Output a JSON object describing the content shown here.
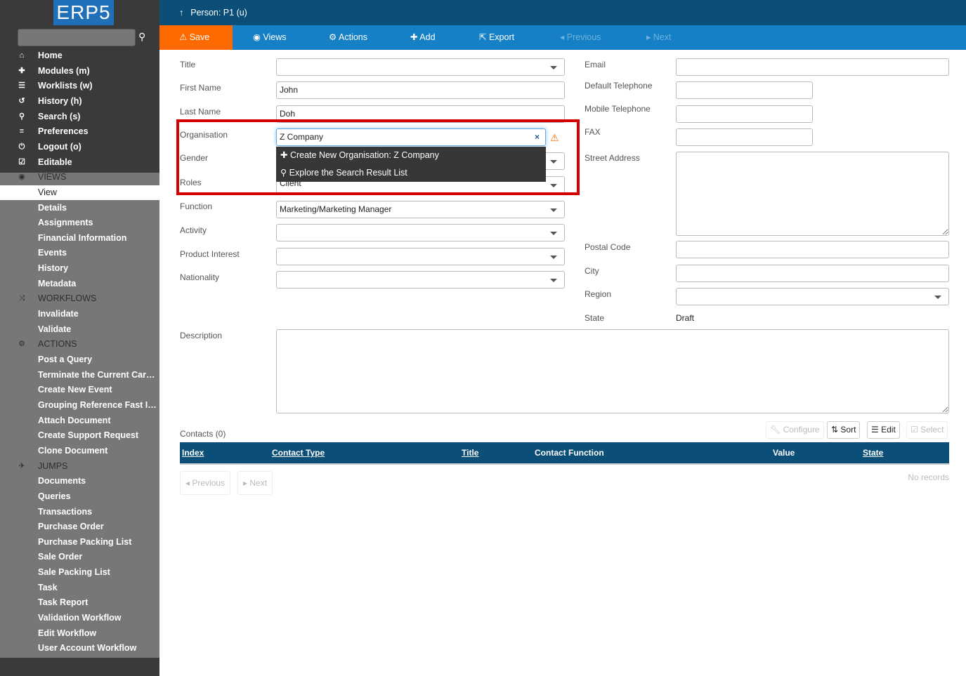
{
  "sidebar": {
    "logo": "ERP5",
    "search_placeholder": "",
    "items": [
      {
        "label": "Home",
        "icon": "home-icon",
        "glyph": "⌂",
        "type": "link"
      },
      {
        "label": "Modules (m)",
        "icon": "puzzle-icon",
        "glyph": "✚",
        "type": "link"
      },
      {
        "label": "Worklists (w)",
        "icon": "list-icon",
        "glyph": "☰",
        "type": "link"
      },
      {
        "label": "History (h)",
        "icon": "history-icon",
        "glyph": "↺",
        "type": "link"
      },
      {
        "label": "Search (s)",
        "icon": "search-icon",
        "glyph": "⚲",
        "type": "link"
      },
      {
        "label": "Preferences",
        "icon": "sliders-icon",
        "glyph": "≡",
        "type": "link"
      },
      {
        "label": "Logout (o)",
        "icon": "power-icon",
        "glyph": "⏻",
        "type": "link"
      },
      {
        "label": "Editable",
        "icon": "checkbox-checked-icon",
        "glyph": "☑",
        "type": "link"
      },
      {
        "label": "VIEWS",
        "icon": "eye-icon",
        "glyph": "◉",
        "type": "section"
      },
      {
        "label": "View",
        "type": "active"
      },
      {
        "label": "Details",
        "type": "link"
      },
      {
        "label": "Assignments",
        "type": "link"
      },
      {
        "label": "Financial Information",
        "type": "link"
      },
      {
        "label": "Events",
        "type": "link"
      },
      {
        "label": "History",
        "type": "link"
      },
      {
        "label": "Metadata",
        "type": "link"
      },
      {
        "label": "WORKFLOWS",
        "icon": "shuffle-icon",
        "glyph": "⤨",
        "type": "section"
      },
      {
        "label": "Invalidate",
        "type": "link"
      },
      {
        "label": "Validate",
        "type": "link"
      },
      {
        "label": "ACTIONS",
        "icon": "gears-icon",
        "glyph": "⚙",
        "type": "section"
      },
      {
        "label": "Post a Query",
        "type": "link"
      },
      {
        "label": "Terminate the Current Career…",
        "type": "link"
      },
      {
        "label": "Create New Event",
        "type": "link"
      },
      {
        "label": "Grouping Reference Fast Input",
        "type": "link"
      },
      {
        "label": "Attach Document",
        "type": "link"
      },
      {
        "label": "Create Support Request",
        "type": "link"
      },
      {
        "label": "Clone Document",
        "type": "link"
      },
      {
        "label": "JUMPS",
        "icon": "plane-icon",
        "glyph": "✈",
        "type": "section"
      },
      {
        "label": "Documents",
        "type": "link"
      },
      {
        "label": "Queries",
        "type": "link"
      },
      {
        "label": "Transactions",
        "type": "link"
      },
      {
        "label": "Purchase Order",
        "type": "link"
      },
      {
        "label": "Purchase Packing List",
        "type": "link"
      },
      {
        "label": "Sale Order",
        "type": "link"
      },
      {
        "label": "Sale Packing List",
        "type": "link"
      },
      {
        "label": "Task",
        "type": "link"
      },
      {
        "label": "Task Report",
        "type": "link"
      },
      {
        "label": "Validation Workflow",
        "type": "link"
      },
      {
        "label": "Edit Workflow",
        "type": "link"
      },
      {
        "label": "User Account Workflow",
        "type": "link"
      }
    ]
  },
  "header": {
    "title": "Person: P1 (u)"
  },
  "toolbar": {
    "save": "Save",
    "views": "Views",
    "actions": "Actions",
    "add": "Add",
    "export": "Export",
    "previous": "Previous",
    "next": "Next"
  },
  "form": {
    "title": {
      "label": "Title",
      "value": ""
    },
    "first_name": {
      "label": "First Name",
      "value": "John"
    },
    "last_name": {
      "label": "Last Name",
      "value": "Doh"
    },
    "organisation": {
      "label": "Organisation",
      "value": "Z Company"
    },
    "gender": {
      "label": "Gender",
      "value": ""
    },
    "roles": {
      "label": "Roles",
      "value": "Client"
    },
    "function": {
      "label": "Function",
      "value": "Marketing/Marketing Manager"
    },
    "activity": {
      "label": "Activity",
      "value": ""
    },
    "product_interest": {
      "label": "Product Interest",
      "value": ""
    },
    "nationality": {
      "label": "Nationality",
      "value": ""
    },
    "email": {
      "label": "Email",
      "value": ""
    },
    "default_telephone": {
      "label": "Default Telephone",
      "value": ""
    },
    "mobile_telephone": {
      "label": "Mobile Telephone",
      "value": ""
    },
    "fax": {
      "label": "FAX",
      "value": ""
    },
    "street_address": {
      "label": "Street Address",
      "value": ""
    },
    "postal_code": {
      "label": "Postal Code",
      "value": ""
    },
    "city": {
      "label": "City",
      "value": ""
    },
    "region": {
      "label": "Region",
      "value": ""
    },
    "state": {
      "label": "State",
      "value": "Draft"
    },
    "description": {
      "label": "Description",
      "value": ""
    }
  },
  "autocomplete": {
    "create": "Create New Organisation: Z Company",
    "explore": "Explore the Search Result List"
  },
  "contacts": {
    "title": "Contacts (0)",
    "buttons": {
      "configure": "Configure",
      "sort": "Sort",
      "edit": "Edit",
      "select": "Select"
    },
    "columns": [
      "Index",
      "Contact Type",
      "Title",
      "Contact Function",
      "Value",
      "State"
    ],
    "empty": "No records",
    "previous": "Previous",
    "next": "Next"
  },
  "colors": {
    "header": "#0b4f78",
    "toolbar": "#1580c5",
    "save": "#ff6a00",
    "highlight": "#d40000"
  }
}
